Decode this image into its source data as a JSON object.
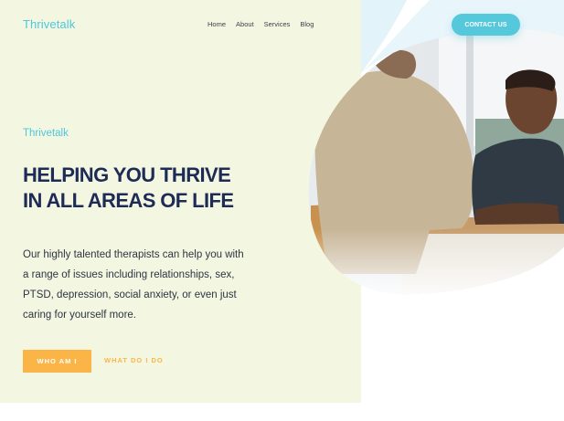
{
  "header": {
    "logo": "Thrivetalk",
    "nav": [
      "Home",
      "About",
      "Services",
      "Blog"
    ],
    "contact_label": "CONTACT US"
  },
  "hero": {
    "tagline": "Thrivetalk",
    "headline": "HELPING YOU THRIVE IN ALL AREAS OF LIFE",
    "body": "Our highly talented therapists can help you with a range of issues including relationships, sex, PTSD, depression, social anxiety, or even just caring for yourself more.",
    "primary_button": "WHO AM I",
    "secondary_link": "WHAT DO I DO",
    "image": "therapy-session-photo"
  },
  "colors": {
    "panel": "#f3f7e2",
    "accent_blue": "#56c8dc",
    "accent_orange": "#fbb546",
    "headline": "#1d2b55"
  }
}
